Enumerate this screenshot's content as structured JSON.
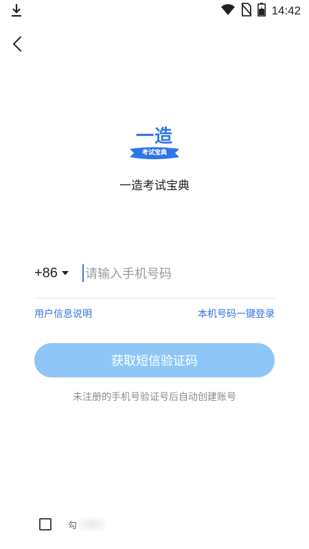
{
  "status_bar": {
    "time": "14:42",
    "icons": [
      "download-icon",
      "wifi-icon",
      "no-sim-icon",
      "battery-charging-icon"
    ]
  },
  "nav": {
    "back_icon": "chevron-left-icon"
  },
  "logo": {
    "text": "一造",
    "ribbon_text": "考试宝典",
    "color": "#2f75e6"
  },
  "app_name": "一造考试宝典",
  "login": {
    "country_code": "+86",
    "phone_placeholder": "请输入手机号码",
    "phone_value": "",
    "user_info_link": "用户信息说明",
    "one_click_link": "本机号码一键登录",
    "sms_button_label": "获取短信验证码",
    "hint": "未注册的手机号验证号后自动创建账号"
  },
  "agreement": {
    "text": "勾",
    "checked": false
  },
  "colors": {
    "accent": "#2f75e6",
    "button_disabled": "#8ec6f7",
    "hint_gray": "#8a8a8a"
  }
}
